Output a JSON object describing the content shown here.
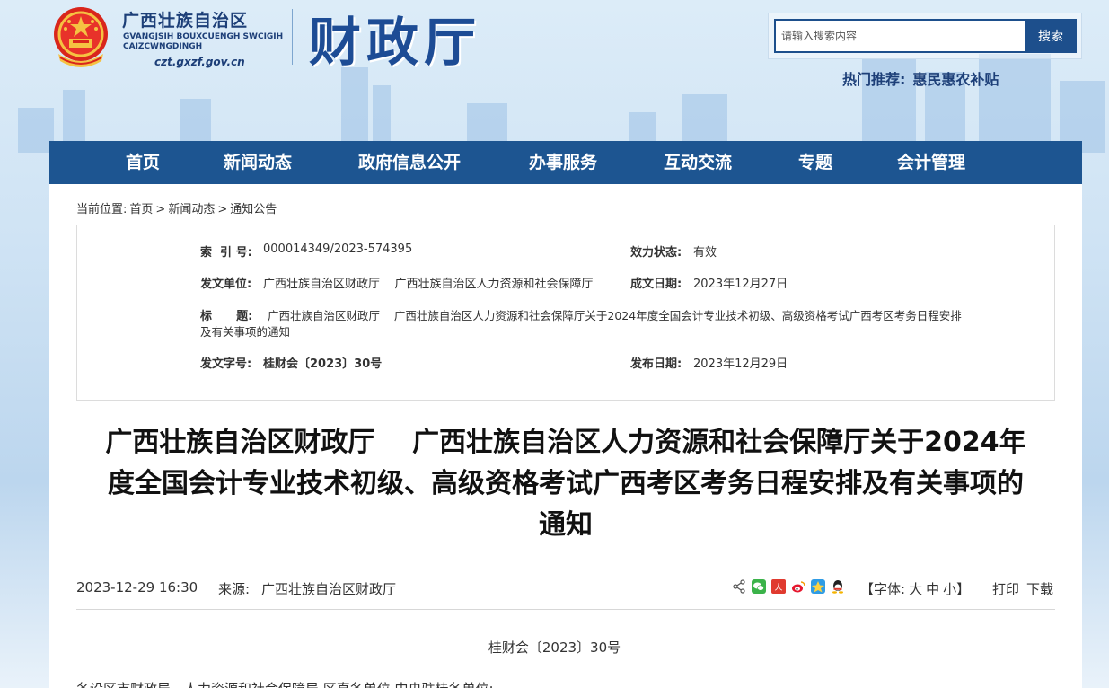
{
  "header": {
    "site_name_cn": "广西壮族自治区",
    "site_name_za": "GVANGJSIH BOUXCUENGH SWCIGIH CAIZCWNGDINGH",
    "site_url": "czt.gxzf.gov.cn",
    "dept_name": "财政厅",
    "search": {
      "placeholder": "请输入搜索内容",
      "button_label": "搜索"
    },
    "hot_recommend": {
      "label": "热门推荐:",
      "link": "惠民惠农补贴"
    }
  },
  "nav": {
    "items": [
      {
        "label": "首页"
      },
      {
        "label": "新闻动态"
      },
      {
        "label": "政府信息公开"
      },
      {
        "label": "办事服务"
      },
      {
        "label": "互动交流"
      },
      {
        "label": "专题"
      },
      {
        "label": "会计管理"
      }
    ]
  },
  "breadcrumb": {
    "prefix": "当前位置:",
    "items": [
      "首页",
      "新闻动态",
      "通知公告"
    ],
    "separator": ">"
  },
  "info": {
    "index_label": "索  引 号:",
    "index_value": "000014349/2023-574395",
    "status_label": "效力状态:",
    "status_value": "有效",
    "issuer_label": "发文单位:",
    "issuer_value": "广西壮族自治区财政厅    广西壮族自治区人力资源和社会保障厅",
    "written_date_label": "成文日期:",
    "written_date_value": "2023年12月27日",
    "title_label": "标      题:",
    "title_value_line1": "广西壮族自治区财政厅    广西壮族自治区人力资源和社会保障厅关于2024年度全国会计专业技术初级、高级资格考试广西考区考务日程安排",
    "title_value_line2": "及有关事项的通知",
    "doc_no_label": "发文字号:",
    "doc_no_value": "桂财会〔2023〕30号",
    "publish_date_label": "发布日期:",
    "publish_date_value": "2023年12月29日"
  },
  "article": {
    "title_line1": "广西壮族自治区财政厅    广西壮族自治区人力资源和社会保障厅关于2024年",
    "title_line2": "度全国会计专业技术初级、高级资格考试广西考区考务日程安排及有关事项的",
    "title_line3": "通知",
    "datetime": "2023-12-29 16:30",
    "source_label": "来源:",
    "source": "广西壮族自治区财政厅",
    "font_size_label_open": "【字体:",
    "font_size_options": [
      "大",
      "中",
      "小"
    ],
    "font_size_label_close": "】",
    "print_label": "打印",
    "download_label": "下载",
    "doc_number": "桂财会〔2023〕30号",
    "salutation": "各设区市财政局、人力资源和社会保障局,区直各单位,中央驻桂各单位:"
  },
  "colors": {
    "nav_bg": "#1d5591",
    "search_button_bg": "#1d4f8c",
    "brand_blue": "#1d4c95"
  },
  "share_icons": [
    "share-icon",
    "wechat-icon",
    "renren-icon",
    "weibo-icon",
    "qzone-icon",
    "qq-icon"
  ]
}
